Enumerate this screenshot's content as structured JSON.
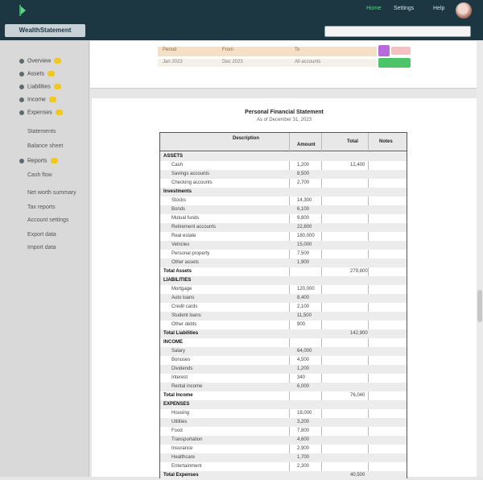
{
  "topbar": {
    "links": [
      "Home",
      "Settings",
      "Help"
    ]
  },
  "brand": {
    "title": "WealthStatement"
  },
  "search": {
    "placeholder": ""
  },
  "sidebar": {
    "items": [
      {
        "label": "Overview",
        "badge": true,
        "dot": true
      },
      {
        "label": "Assets",
        "badge": true,
        "dot": true
      },
      {
        "label": "Liabilities",
        "badge": true,
        "dot": true
      },
      {
        "label": "Income",
        "badge": true,
        "dot": true
      },
      {
        "label": "Expenses",
        "badge": true,
        "dot": true
      },
      {
        "label": "Statements",
        "badge": false,
        "dot": false
      },
      {
        "label": "Balance sheet",
        "badge": false,
        "dot": false
      },
      {
        "label": "Reports",
        "badge": true,
        "dot": true
      },
      {
        "label": "Cash flow",
        "badge": false,
        "dot": false
      },
      {
        "label": "Net worth summary",
        "badge": false,
        "dot": false
      },
      {
        "label": "Tax reports",
        "badge": false,
        "dot": false
      },
      {
        "label": "Account settings",
        "badge": false,
        "dot": false
      },
      {
        "label": "Export data",
        "badge": false,
        "dot": false
      },
      {
        "label": "Import data",
        "badge": false,
        "dot": false
      }
    ]
  },
  "toolbar": {
    "row1": [
      "Period",
      "From",
      "To"
    ],
    "row2": [
      "Jan 2023",
      "Dec 2023",
      "All accounts"
    ]
  },
  "document": {
    "title": "Personal Financial Statement",
    "subtitle": "As of December 31, 2023",
    "headers": [
      "Description",
      "Amount",
      "Total",
      "Notes"
    ],
    "rows": [
      {
        "label": "ASSETS",
        "section": true,
        "v1": "",
        "v2": "",
        "v3": ""
      },
      {
        "label": "Cash",
        "section": false,
        "v1": "1,200",
        "v2": "12,400",
        "v3": ""
      },
      {
        "label": "Savings accounts",
        "section": false,
        "v1": "8,500",
        "v2": "",
        "v3": ""
      },
      {
        "label": "Checking accounts",
        "section": false,
        "v1": "2,700",
        "v2": "",
        "v3": ""
      },
      {
        "label": "Investments",
        "section": true,
        "v1": "",
        "v2": "",
        "v3": ""
      },
      {
        "label": "Stocks",
        "section": false,
        "v1": "14,300",
        "v2": "",
        "v3": ""
      },
      {
        "label": "Bonds",
        "section": false,
        "v1": "6,100",
        "v2": "",
        "v3": ""
      },
      {
        "label": "Mutual funds",
        "section": false,
        "v1": "9,800",
        "v2": "",
        "v3": ""
      },
      {
        "label": "Retirement accounts",
        "section": false,
        "v1": "22,600",
        "v2": "",
        "v3": ""
      },
      {
        "label": "Real estate",
        "section": false,
        "v1": "180,000",
        "v2": "",
        "v3": ""
      },
      {
        "label": "Vehicles",
        "section": false,
        "v1": "15,000",
        "v2": "",
        "v3": ""
      },
      {
        "label": "Personal property",
        "section": false,
        "v1": "7,500",
        "v2": "",
        "v3": ""
      },
      {
        "label": "Other assets",
        "section": false,
        "v1": "1,900",
        "v2": "",
        "v3": ""
      },
      {
        "label": "Total Assets",
        "section": true,
        "v1": "",
        "v2": "279,800",
        "v3": ""
      },
      {
        "label": "LIABILITIES",
        "section": true,
        "v1": "",
        "v2": "",
        "v3": ""
      },
      {
        "label": "Mortgage",
        "section": false,
        "v1": "120,000",
        "v2": "",
        "v3": ""
      },
      {
        "label": "Auto loans",
        "section": false,
        "v1": "8,400",
        "v2": "",
        "v3": ""
      },
      {
        "label": "Credit cards",
        "section": false,
        "v1": "2,100",
        "v2": "",
        "v3": ""
      },
      {
        "label": "Student loans",
        "section": false,
        "v1": "11,500",
        "v2": "",
        "v3": ""
      },
      {
        "label": "Other debts",
        "section": false,
        "v1": "900",
        "v2": "",
        "v3": ""
      },
      {
        "label": "Total Liabilities",
        "section": true,
        "v1": "",
        "v2": "142,900",
        "v3": ""
      },
      {
        "label": "INCOME",
        "section": true,
        "v1": "",
        "v2": "",
        "v3": ""
      },
      {
        "label": "Salary",
        "section": false,
        "v1": "64,000",
        "v2": "",
        "v3": ""
      },
      {
        "label": "Bonuses",
        "section": false,
        "v1": "4,500",
        "v2": "",
        "v3": ""
      },
      {
        "label": "Dividends",
        "section": false,
        "v1": "1,200",
        "v2": "",
        "v3": ""
      },
      {
        "label": "Interest",
        "section": false,
        "v1": "340",
        "v2": "",
        "v3": ""
      },
      {
        "label": "Rental income",
        "section": false,
        "v1": "6,000",
        "v2": "",
        "v3": ""
      },
      {
        "label": "Total Income",
        "section": true,
        "v1": "",
        "v2": "76,040",
        "v3": ""
      },
      {
        "label": "EXPENSES",
        "section": true,
        "v1": "",
        "v2": "",
        "v3": ""
      },
      {
        "label": "Housing",
        "section": false,
        "v1": "18,000",
        "v2": "",
        "v3": ""
      },
      {
        "label": "Utilities",
        "section": false,
        "v1": "3,200",
        "v2": "",
        "v3": ""
      },
      {
        "label": "Food",
        "section": false,
        "v1": "7,800",
        "v2": "",
        "v3": ""
      },
      {
        "label": "Transportation",
        "section": false,
        "v1": "4,600",
        "v2": "",
        "v3": ""
      },
      {
        "label": "Insurance",
        "section": false,
        "v1": "2,900",
        "v2": "",
        "v3": ""
      },
      {
        "label": "Healthcare",
        "section": false,
        "v1": "1,700",
        "v2": "",
        "v3": ""
      },
      {
        "label": "Entertainment",
        "section": false,
        "v1": "2,300",
        "v2": "",
        "v3": ""
      },
      {
        "label": "Total Expenses",
        "section": true,
        "v1": "",
        "v2": "40,500",
        "v3": ""
      }
    ]
  },
  "colors": {
    "topbar": "#1c3742",
    "accent": "#4cc46a",
    "badge": "#f2c81f"
  }
}
